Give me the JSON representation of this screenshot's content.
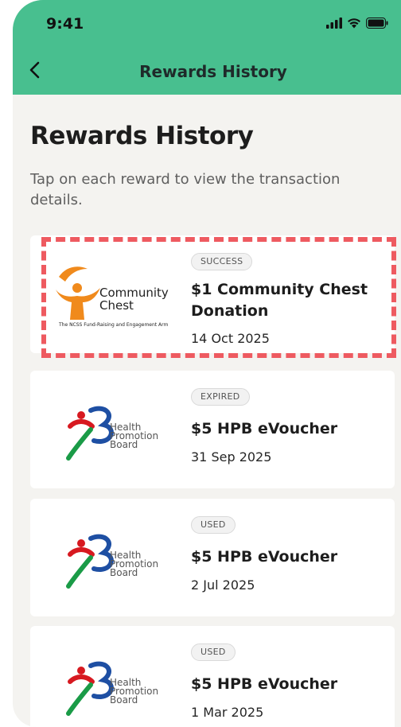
{
  "status_bar": {
    "time": "9:41"
  },
  "nav": {
    "title": "Rewards History"
  },
  "page": {
    "heading": "Rewards History",
    "description": "Tap on each reward to view the transaction details."
  },
  "logos": {
    "community_chest": {
      "line1": "Community",
      "line2": "Chest",
      "tagline": "The NCSS Fund-Raising and Engagement Arm"
    },
    "hpb": {
      "line1": "Health",
      "line2": "Promotion",
      "line3": "Board"
    }
  },
  "rewards": [
    {
      "status": "SUCCESS",
      "title": "$1 Community Chest Donation",
      "date": "14 Oct 2025"
    },
    {
      "status": "EXPIRED",
      "title": "$5 HPB eVoucher",
      "date": "31 Sep 2025"
    },
    {
      "status": "USED",
      "title": "$5 HPB eVoucher",
      "date": "2 Jul 2025"
    },
    {
      "status": "USED",
      "title": "$5 HPB eVoucher",
      "date": "1 Mar 2025"
    }
  ],
  "colors": {
    "header": "#48bf8f",
    "background": "#f4f3f0",
    "highlight": "#ee5a60"
  }
}
